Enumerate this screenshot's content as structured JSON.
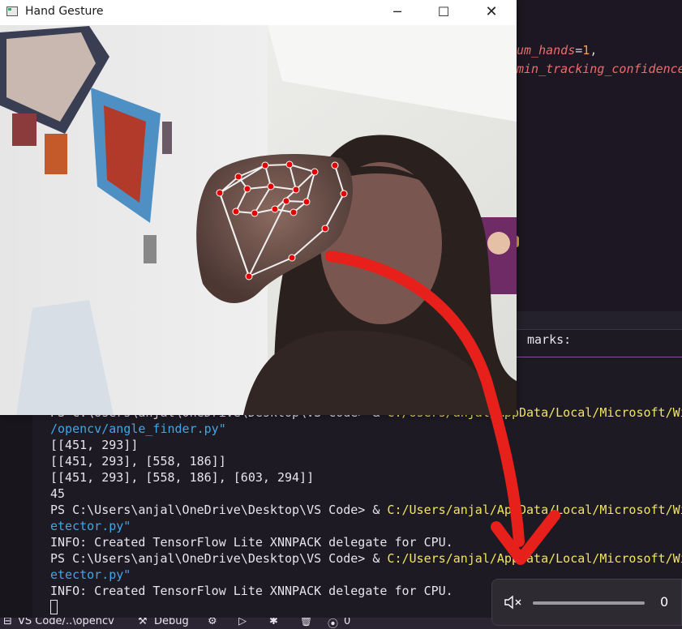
{
  "window": {
    "title": "Hand Gesture",
    "minimize_icon": "minimize-icon",
    "maximize_icon": "maximize-icon",
    "close_icon": "close-icon"
  },
  "editor": {
    "line1_name": "um_hands",
    "line1_eq": "=",
    "line1_value": "1",
    "line1_comma": ",",
    "line2_name": "min_tracking_confidence"
  },
  "terminal": {
    "right_partial": "marks:",
    "line1_hidden": "PS C:\\Users\\anjal\\OneDrive\\Desktop\\VS Code> & ",
    "line1_path": "C:/Users/anjal/AppData/Local/Microsoft/Wi",
    "line2": "/opencv/angle_finder.py\"",
    "line3": "[[451, 293]]",
    "line4": "[[451, 293], [558, 186]]",
    "line5": "[[451, 293], [558, 186], [603, 294]]",
    "line6": "45",
    "line7_prompt": "PS C:\\Users\\anjal\\OneDrive\\Desktop\\VS Code> & ",
    "line7_path": "C:/Users/anjal/AppData/Local/Microsoft/Wi",
    "line8": "etector.py\"",
    "line9": "INFO: Created TensorFlow Lite XNNPACK delegate for CPU.",
    "line10_prompt": "PS C:\\Users\\anjal\\OneDrive\\Desktop\\VS Code> & ",
    "line10_path": "C:/Users/anjal/AppData/Local/Microsoft/Wi",
    "line11": "etector.py\"",
    "line12": "INFO: Created TensorFlow Lite XNNPACK delegate for CPU."
  },
  "statusbar": {
    "folder": "VS Code/..\\opencv",
    "debug": "Debug",
    "ports": "0"
  },
  "volume": {
    "icon": "speaker-mute-icon",
    "level_percent": 0,
    "value_label": "0"
  },
  "colors": {
    "keyword": "#f06c6c",
    "number": "#f5a05a",
    "path": "#f1e55f",
    "path_cont": "#3ea7e8",
    "landmark": "#e60000",
    "arrow": "#e8201b"
  }
}
